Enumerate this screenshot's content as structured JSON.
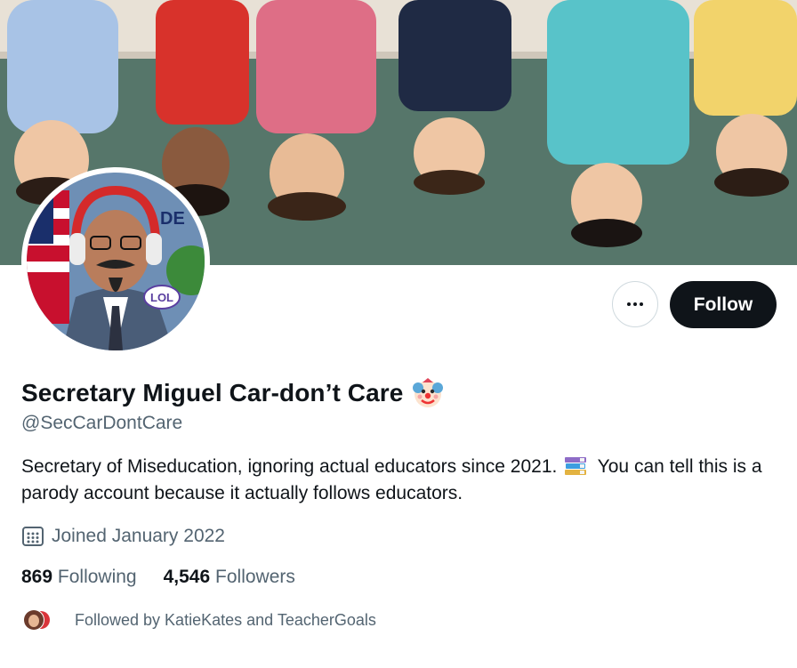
{
  "profile": {
    "display_name": "Secretary Miguel Car-don’t Care",
    "name_emoji": "clown-face",
    "handle": "@SecCarDontCare",
    "bio_part1": "Secretary of Miseducation, ignoring actual educators since 2021.",
    "bio_emoji": "books",
    "bio_part2": "You can tell this is a parody account because it actually follows educators.",
    "joined": "Joined January 2022",
    "following_count": "869",
    "following_label": "Following",
    "followers_count": "4,546",
    "followers_label": "Followers",
    "followed_by": "Followed by KatieKates and TeacherGoals",
    "avatar_sticker_text": "LOL",
    "avatar_sign_text": "DE"
  },
  "actions": {
    "follow_label": "Follow",
    "more_icon": "more-horizontal-icon"
  },
  "colors": {
    "primary_text": "#0f1419",
    "secondary_text": "#536471",
    "follow_bg": "#0f1419",
    "border": "#cfd9de"
  }
}
